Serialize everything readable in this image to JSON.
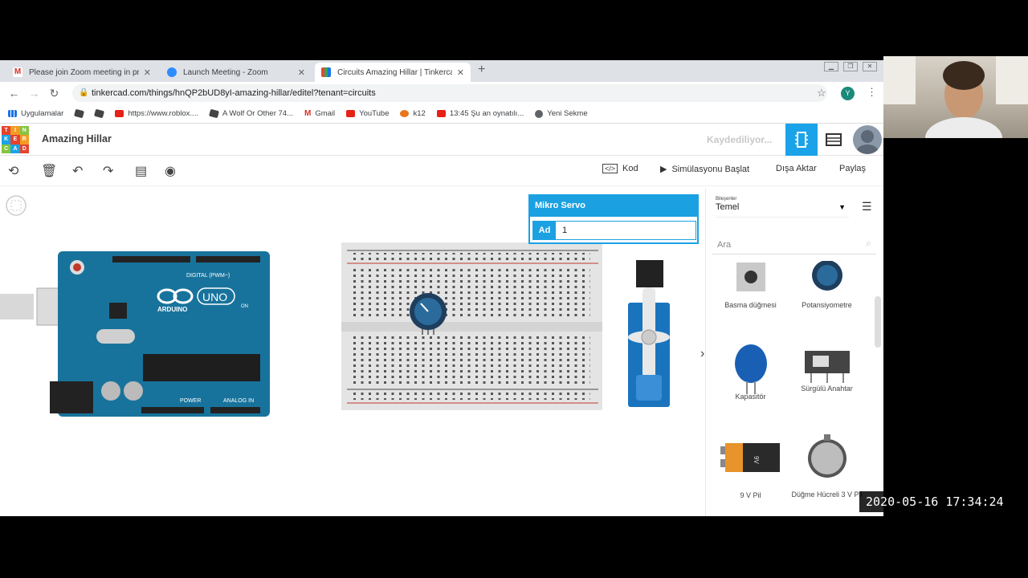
{
  "tabs": [
    {
      "title": "Please join Zoom meeting in pro",
      "favicon_color": "#d93025"
    },
    {
      "title": "Launch Meeting - Zoom",
      "favicon_color": "#2d8cff"
    },
    {
      "title": "Circuits Amazing Hillar | Tinkerca",
      "favicon_color": "#e8453c"
    }
  ],
  "url": "tinkercad.com/things/hnQP2bUD8yI-amazing-hillar/editel?tenant=circuits",
  "avatar_letter": "Y",
  "bookmarks": [
    {
      "label": "Uygulamalar",
      "color": "#1a73e8"
    },
    {
      "label": "",
      "color": "#444"
    },
    {
      "label": "",
      "color": "#444"
    },
    {
      "label": "https://www.roblox....",
      "color": "#e62117"
    },
    {
      "label": "A Wolf Or Other 74...",
      "color": "#444"
    },
    {
      "label": "Gmail",
      "color": "#d93025"
    },
    {
      "label": "YouTube",
      "color": "#e62117"
    },
    {
      "label": "k12",
      "color": "#e8741c"
    },
    {
      "label": "13:45 Şu an oynatılı...",
      "color": "#e62117"
    },
    {
      "label": "Yeni Sekme",
      "color": "#444"
    }
  ],
  "app": {
    "logo_letters": [
      "T",
      "I",
      "N",
      "K",
      "E",
      "R",
      "C",
      "A",
      "D"
    ],
    "project_name": "Amazing Hillar",
    "save_status": "Kaydediliyor..."
  },
  "toolbar": {
    "code": "Kod",
    "simulate": "Simülasyonu Başlat",
    "export": "Dışa Aktar",
    "share": "Paylaş"
  },
  "inspector": {
    "title": "Mikro Servo",
    "name_label": "Ad",
    "name_value": "1"
  },
  "panel": {
    "category_caption": "Bileşenler",
    "category": "Temel",
    "search_placeholder": "Ara",
    "components": [
      {
        "label": "Basma düğmesi"
      },
      {
        "label": "Potansiyometre"
      },
      {
        "label": "Kapasitör"
      },
      {
        "label": "Sürgülü Anahtar"
      },
      {
        "label": "9 V Pil"
      },
      {
        "label": "Düğme Hücreli 3 V Pil"
      }
    ]
  },
  "arduino": {
    "brand": "ARDUINO",
    "model": "UNO",
    "digital": "DIGITAL (PWM~)",
    "power": "POWER",
    "analog": "ANALOG IN",
    "on": "ON"
  },
  "battery_text": "9V",
  "timestamp": "2020-05-16 17:34:24"
}
